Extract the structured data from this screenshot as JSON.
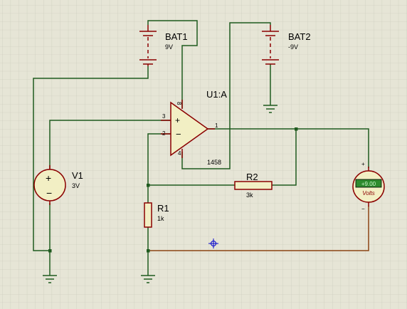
{
  "components": {
    "bat1": {
      "ref": "BAT1",
      "value": "9V"
    },
    "bat2": {
      "ref": "BAT2",
      "value": "-9V"
    },
    "opamp": {
      "ref": "U1:A",
      "part": "1458",
      "pins": {
        "noninv": "3",
        "inv": "2",
        "out": "1",
        "vplus": "8",
        "vminus": "4"
      }
    },
    "v1": {
      "ref": "V1",
      "value": "3V"
    },
    "r1": {
      "ref": "R1",
      "value": "1k"
    },
    "r2": {
      "ref": "R2",
      "value": "3k"
    },
    "voltmeter": {
      "unit": "Volts",
      "reading": "+9.00",
      "plus": "+",
      "minus": "−"
    }
  },
  "colors": {
    "background": "#e6e5d6",
    "grid": "#c7c6b8",
    "wire": "#1f5b1f",
    "component_outline": "#8b0000",
    "body_fill": "#f2efc4",
    "meter_display": "#2e8b2e",
    "probe_wire": "#8b4513",
    "cursor": "#0000cc"
  }
}
